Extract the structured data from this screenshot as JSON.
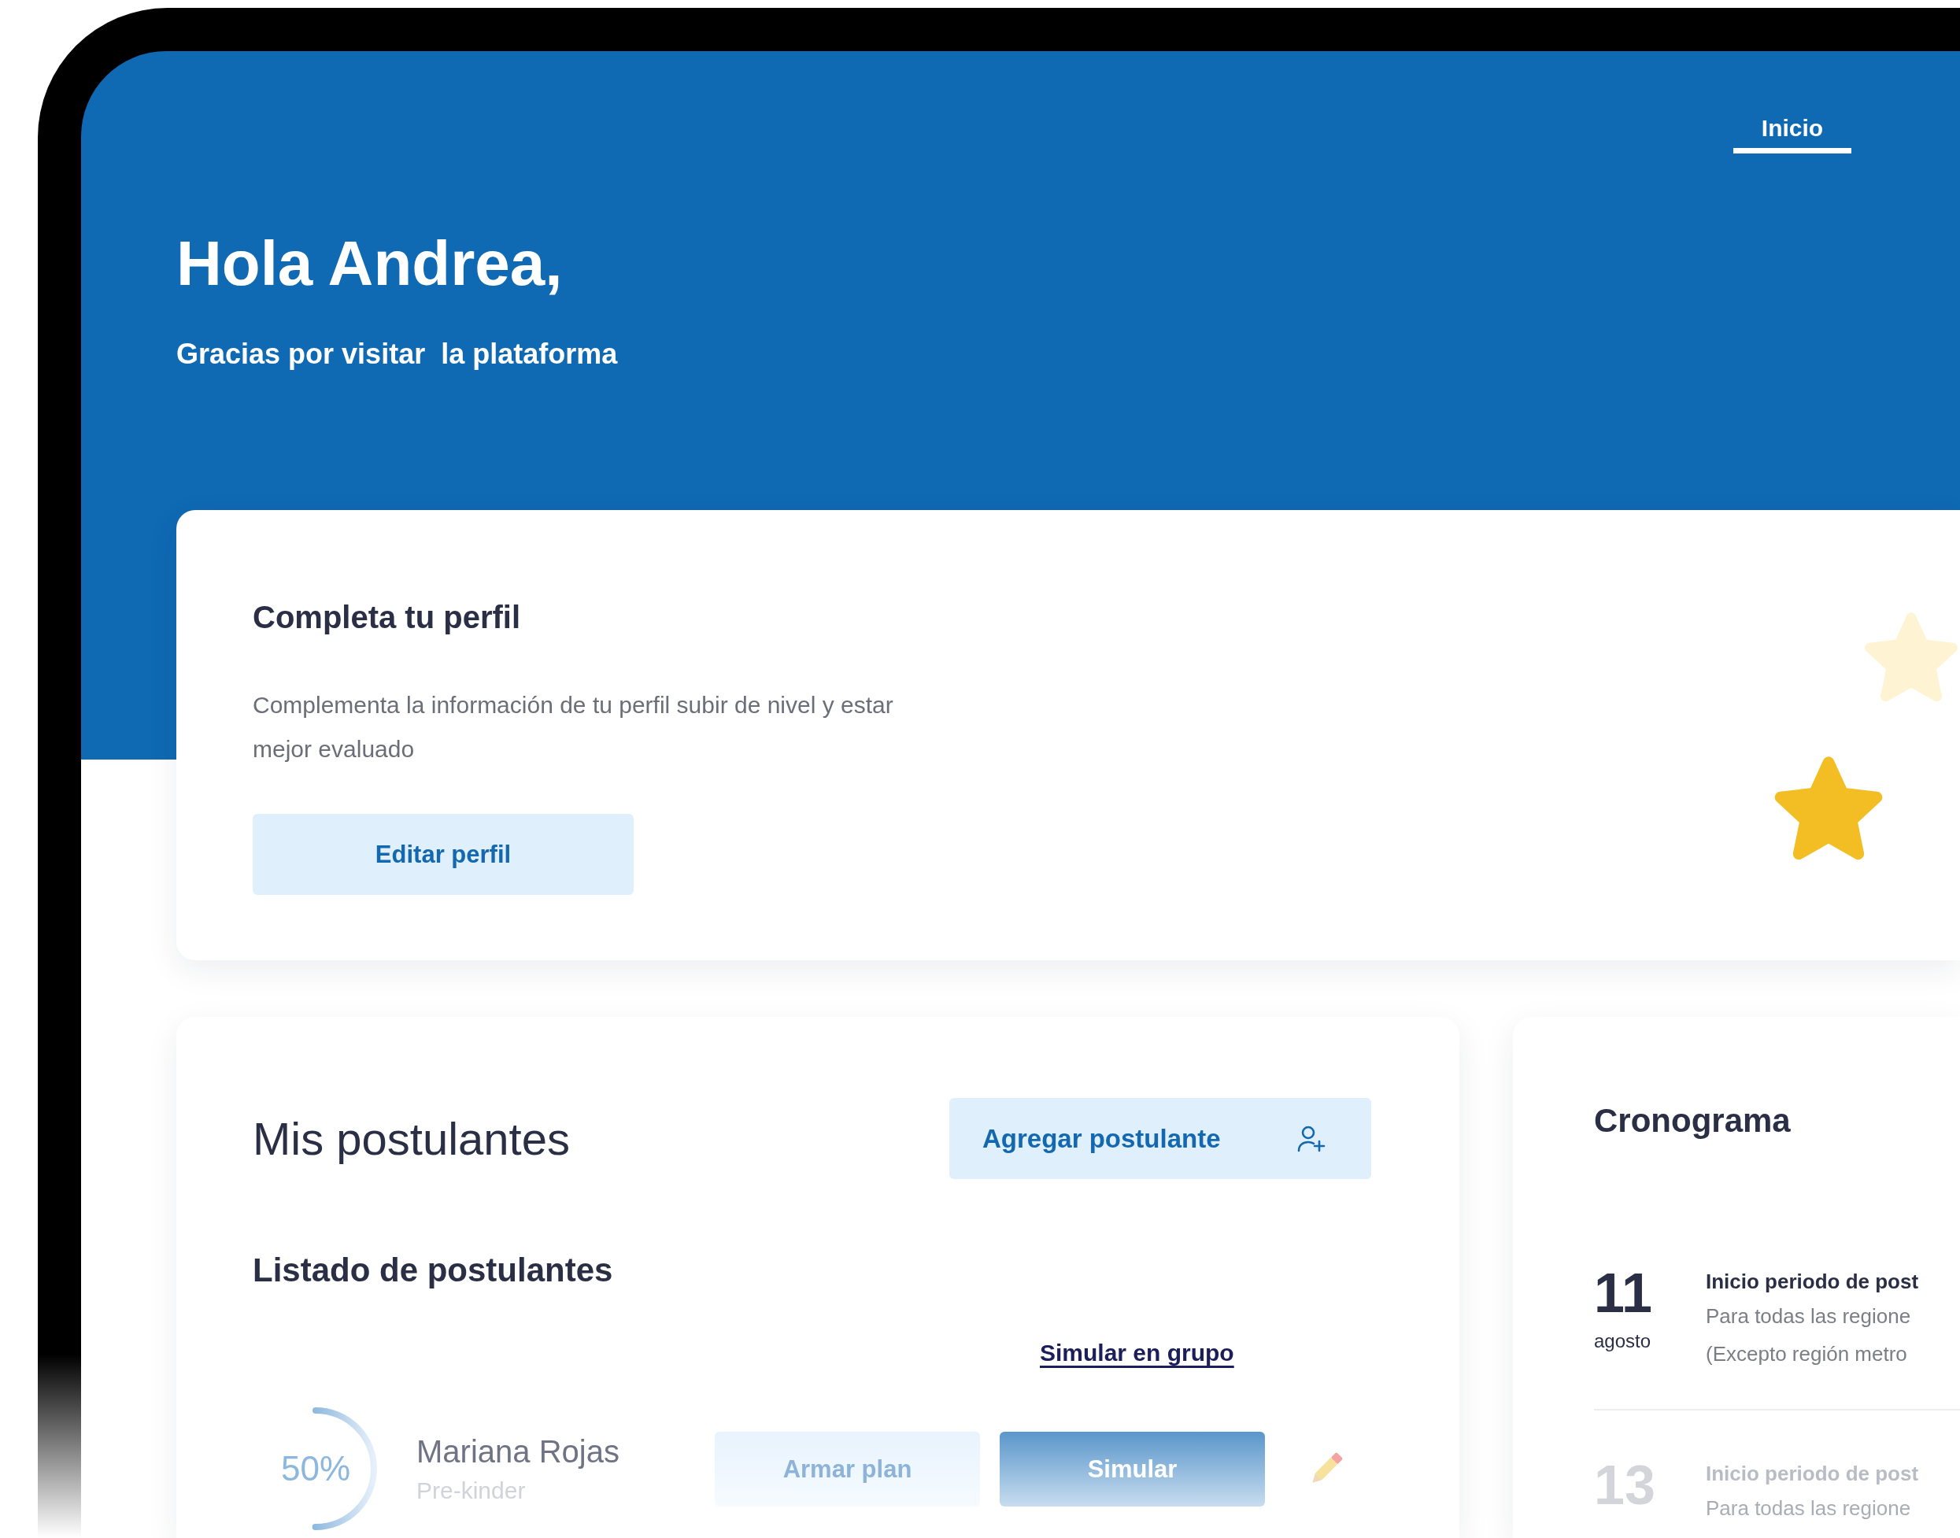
{
  "nav": {
    "tabs": [
      {
        "label": "Inicio",
        "selected": true
      }
    ]
  },
  "greeting": {
    "title": "Hola Andrea,",
    "subtitle": "Gracias por visitar  la plataforma"
  },
  "profile_card": {
    "title": "Completa tu perfil",
    "description": "Complementa la información de tu perfil subir de nivel y estar mejor evaluado",
    "button": "Editar perfil"
  },
  "applicants": {
    "title": "Mis postulantes",
    "add_button": "Agregar postulante",
    "list_title": "Listado de postulantes",
    "group_link": "Simular en grupo",
    "rows": [
      {
        "progress": "50%",
        "level": 0.5,
        "name": "Mariana Rojas",
        "grade": "Pre-kinder",
        "plan_button": "Armar plan",
        "simulate_button": "Simular"
      }
    ]
  },
  "schedule": {
    "title": "Cronograma",
    "events": [
      {
        "day": "11",
        "month": "agosto",
        "title": "Inicio periodo de post",
        "description": [
          "Para todas las regione",
          "(Excepto región metro"
        ],
        "dimmed": false
      },
      {
        "day": "13",
        "title": "Inicio periodo de post",
        "description": [
          "Para todas las regione"
        ],
        "dimmed": true
      }
    ]
  }
}
